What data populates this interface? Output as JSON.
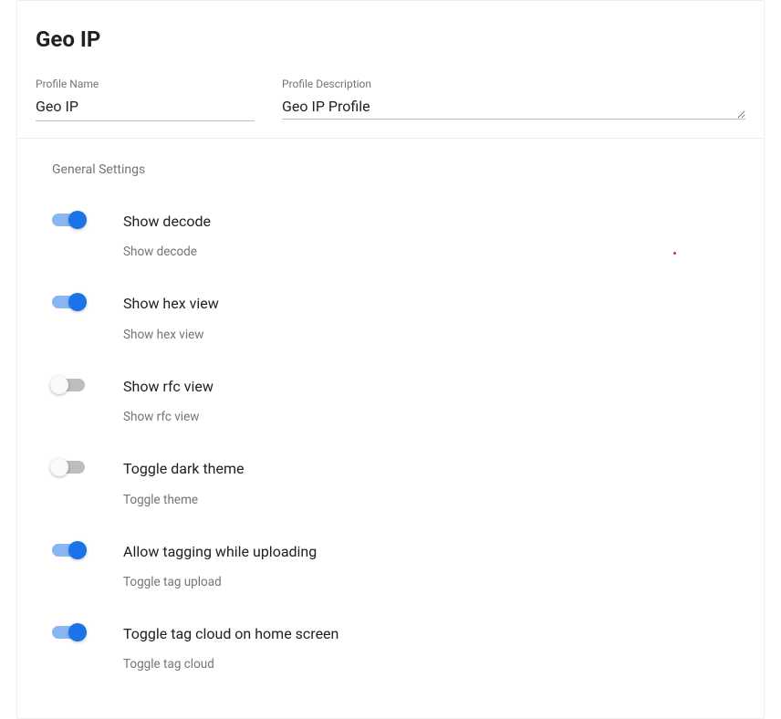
{
  "header": {
    "title": "Geo IP"
  },
  "fields": {
    "profile_name": {
      "label": "Profile Name",
      "value": "Geo IP"
    },
    "profile_description": {
      "label": "Profile Description",
      "value": "Geo IP Profile"
    }
  },
  "section": {
    "general_label": "General Settings"
  },
  "settings": [
    {
      "key": "show-decode",
      "title": "Show decode",
      "desc": "Show decode",
      "on": true
    },
    {
      "key": "show-hex-view",
      "title": "Show hex view",
      "desc": "Show hex view",
      "on": true
    },
    {
      "key": "show-rfc-view",
      "title": "Show rfc view",
      "desc": "Show rfc view",
      "on": false
    },
    {
      "key": "dark-theme",
      "title": "Toggle dark theme",
      "desc": "Toggle theme",
      "on": false
    },
    {
      "key": "tag-upload",
      "title": "Allow tagging while uploading",
      "desc": "Toggle tag upload",
      "on": true
    },
    {
      "key": "tag-cloud",
      "title": "Toggle tag cloud on home screen",
      "desc": "Toggle tag cloud",
      "on": true
    }
  ]
}
